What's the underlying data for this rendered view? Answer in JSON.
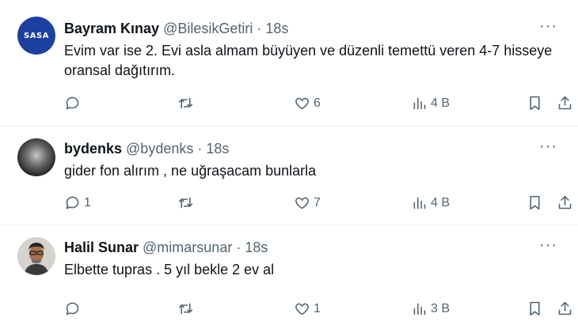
{
  "tweets": [
    {
      "name": "Bayram Kınay",
      "handle": "@BilesikGetiri",
      "separator": "·",
      "time": "18s",
      "text": "Evim var ise 2. Evi asla almam büyüyen ve düzenli temettü veren 4-7 hisseye oransal dağıtırım.",
      "avatar_text": "SASA",
      "avatar_color": "#1d3fa0",
      "replies": "",
      "retweets": "",
      "likes": "6",
      "views": "4 B"
    },
    {
      "name": "bydenks",
      "handle": "@bydenks",
      "separator": "·",
      "time": "18s",
      "text": "gider fon alırım , ne uğraşacam bunlarla",
      "replies": "1",
      "retweets": "",
      "likes": "7",
      "views": "4 B"
    },
    {
      "name": "Halil Sunar",
      "handle": "@mimarsunar",
      "separator": "·",
      "time": "18s",
      "text": "Elbette tupras . 5 yıl bekle 2 ev al",
      "replies": "",
      "retweets": "",
      "likes": "1",
      "views": "3 B"
    }
  ],
  "icons": {
    "more": "more-horizontal-icon",
    "reply": "reply-icon",
    "retweet": "retweet-icon",
    "like": "heart-icon",
    "views": "views-chart-icon",
    "bookmark": "bookmark-icon",
    "share": "share-icon"
  },
  "more_glyph": "···"
}
